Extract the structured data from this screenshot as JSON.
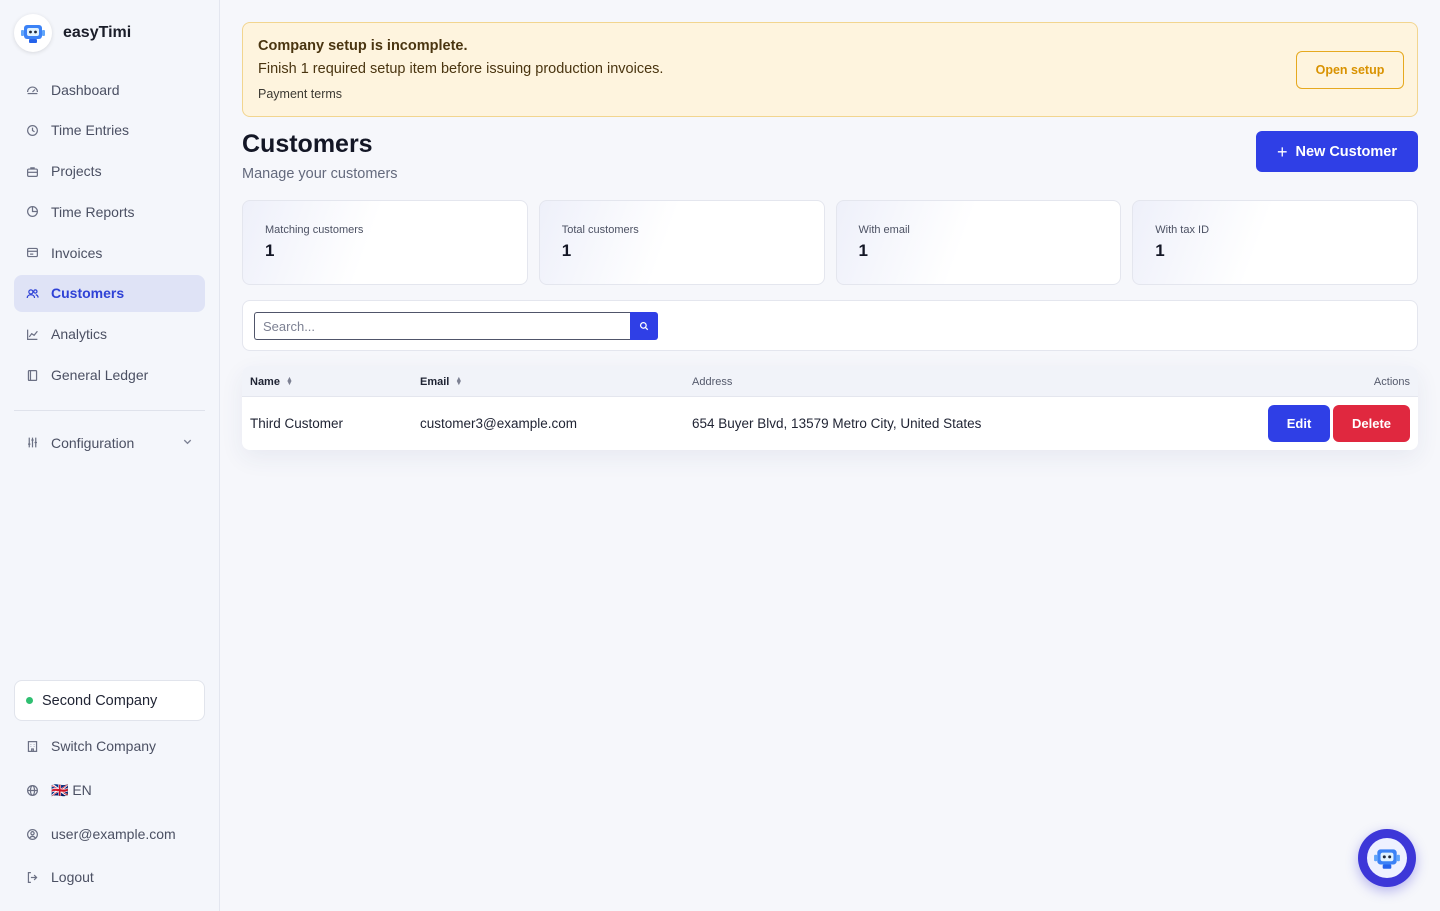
{
  "app": {
    "name": "easyTimi"
  },
  "sidebar": {
    "items": [
      {
        "label": "Dashboard",
        "icon": "dashboard-icon"
      },
      {
        "label": "Time Entries",
        "icon": "clock-icon"
      },
      {
        "label": "Projects",
        "icon": "briefcase-icon"
      },
      {
        "label": "Time Reports",
        "icon": "pie-chart-icon"
      },
      {
        "label": "Invoices",
        "icon": "invoice-icon"
      },
      {
        "label": "Customers",
        "icon": "users-icon",
        "active": true
      },
      {
        "label": "Analytics",
        "icon": "line-chart-icon"
      },
      {
        "label": "General Ledger",
        "icon": "book-icon"
      }
    ],
    "configuration": {
      "label": "Configuration",
      "icon": "sliders-icon"
    },
    "company": {
      "name": "Second Company",
      "status_color": "#2fbf71"
    },
    "switch_company": "Switch Company",
    "language": "🇬🇧 EN",
    "user": "user@example.com",
    "logout": "Logout"
  },
  "banner": {
    "title": "Company setup is incomplete.",
    "text": "Finish 1 required setup item before issuing production invoices.",
    "item": "Payment terms",
    "button": "Open setup"
  },
  "page": {
    "title": "Customers",
    "subtitle": "Manage your customers",
    "new_button": "New Customer"
  },
  "stats": [
    {
      "label": "Matching customers",
      "value": "1"
    },
    {
      "label": "Total customers",
      "value": "1"
    },
    {
      "label": "With email",
      "value": "1"
    },
    {
      "label": "With tax ID",
      "value": "1"
    }
  ],
  "search": {
    "placeholder": "Search..."
  },
  "table": {
    "columns": {
      "name": "Name",
      "email": "Email",
      "address": "Address",
      "actions": "Actions"
    },
    "rows": [
      {
        "name": "Third Customer",
        "email": "customer3@example.com",
        "address": "654 Buyer Blvd, 13579 Metro City, United States"
      }
    ],
    "edit_label": "Edit",
    "delete_label": "Delete"
  },
  "colors": {
    "accent": "#2f3fe6",
    "danger": "#e0283f",
    "warning_border": "#e6a91f",
    "warning_bg": "#fef4de"
  }
}
